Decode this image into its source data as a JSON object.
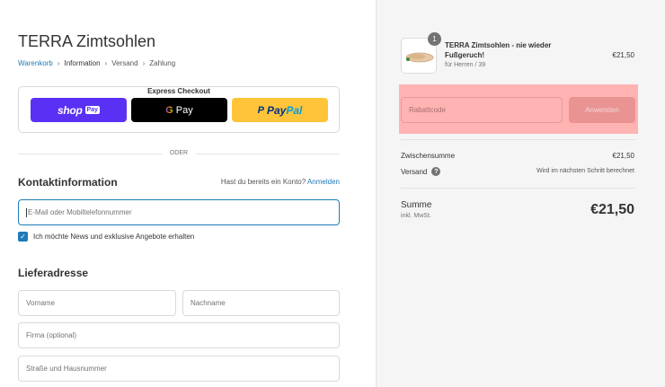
{
  "store": {
    "title": "TERRA Zimtsohlen"
  },
  "breadcrumb": {
    "items": [
      "Warenkorb",
      "Information",
      "Versand",
      "Zahlung"
    ],
    "separator": "›"
  },
  "express": {
    "label": "Express Checkout",
    "shop_word": "shop",
    "shop_pay": "Pay",
    "gpay_g": "G",
    "gpay_label": "Pay",
    "paypal_1": "Pay",
    "paypal_2": "Pal",
    "paypal_icon": "P"
  },
  "or_label": "ODER",
  "contact": {
    "title": "Kontaktinformation",
    "account_prompt": "Hast du bereits ein Konto?",
    "login_link": "Anmelden",
    "email_placeholder": "E-Mail oder Mobiltelefonnummer",
    "newsletter_label": "Ich möchte News und exklusive Angebote erhalten",
    "newsletter_checked": true
  },
  "address": {
    "title": "Lieferadresse",
    "first_name_placeholder": "Vorname",
    "last_name_placeholder": "Nachname",
    "company_placeholder": "Firma (optional)",
    "street_placeholder": "Straße und Hausnummer"
  },
  "order": {
    "product": {
      "name": "TERRA Zimtsohlen - nie wieder Fußgeruch!",
      "variant": "für Herren / 39",
      "price": "€21,50",
      "quantity": "1"
    },
    "discount": {
      "placeholder": "Rabattcode",
      "button": "Anwenden"
    },
    "subtotal_label": "Zwischensumme",
    "subtotal_value": "€21,50",
    "shipping_label": "Versand",
    "shipping_value": "Wird im nächsten Schritt berechnet",
    "total_label": "Summe",
    "tax_note": "inkl. MwSt.",
    "total_value": "€21,50"
  },
  "colors": {
    "accent": "#1f7ab8",
    "shop_pay": "#5a31f4",
    "paypal": "#ffc439",
    "highlight": "#ffb3b3"
  }
}
